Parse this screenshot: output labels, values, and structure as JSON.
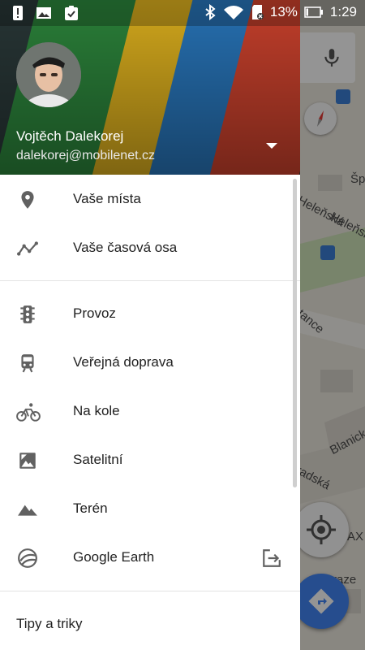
{
  "status_bar": {
    "battery_percent": "13%",
    "time": "1:29",
    "icons": [
      "alert-icon",
      "image-icon",
      "clipboard-check-icon",
      "bluetooth-icon",
      "wifi-icon",
      "sd-card-icon",
      "battery-icon"
    ]
  },
  "account": {
    "name": "Vojtěch Dalekorej",
    "email": "dalekorej@mobilenet.cz"
  },
  "menu": {
    "section1": [
      {
        "label": "Vaše místa",
        "icon": "place-pin-icon"
      },
      {
        "label": "Vaše časová osa",
        "icon": "timeline-icon"
      }
    ],
    "section2": [
      {
        "label": "Provoz",
        "icon": "traffic-light-icon"
      },
      {
        "label": "Veřejná doprava",
        "icon": "train-icon"
      },
      {
        "label": "Na kole",
        "icon": "bicycle-icon"
      },
      {
        "label": "Satelitní",
        "icon": "satellite-icon"
      },
      {
        "label": "Terén",
        "icon": "terrain-icon"
      },
      {
        "label": "Google Earth",
        "icon": "google-earth-icon",
        "trailing_icon": "open-external-icon"
      }
    ],
    "section3": [
      {
        "label": "Tipy a triky"
      }
    ]
  },
  "map": {
    "labels": [
      "Šp",
      "Heleňská",
      "Heleňsk",
      "etance",
      "Blanick",
      "radská",
      "AX",
      "Praze"
    ]
  },
  "colors": {
    "accent_blue": "#4285f4",
    "header_green": "#2e8b3e",
    "header_yellow": "#e7b81f",
    "header_blue": "#2a7bc3",
    "header_red": "#d6452f"
  }
}
